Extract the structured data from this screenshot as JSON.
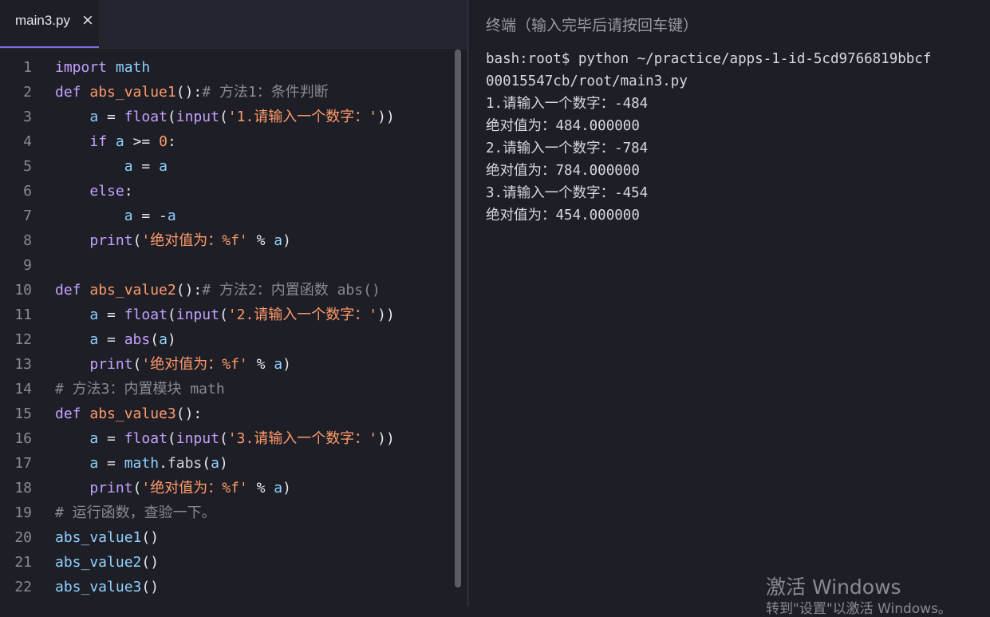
{
  "editor": {
    "tab": {
      "label": "main3.py",
      "close_icon": "×"
    },
    "lines": [
      {
        "n": "1",
        "tokens": [
          [
            "kw",
            "import"
          ],
          [
            "pl",
            " "
          ],
          [
            "id",
            "math"
          ]
        ]
      },
      {
        "n": "2",
        "tokens": [
          [
            "kw",
            "def"
          ],
          [
            "pl",
            " "
          ],
          [
            "fn",
            "abs_value1"
          ],
          [
            "op",
            "():"
          ],
          [
            "cm",
            "# 方法1：条件判断"
          ]
        ]
      },
      {
        "n": "3",
        "tokens": [
          [
            "pl",
            "    "
          ],
          [
            "id",
            "a"
          ],
          [
            "op",
            " = "
          ],
          [
            "kw",
            "float"
          ],
          [
            "op",
            "("
          ],
          [
            "kw",
            "input"
          ],
          [
            "op",
            "("
          ],
          [
            "str",
            "'1.请输入一个数字：'"
          ],
          [
            "op",
            "))"
          ]
        ]
      },
      {
        "n": "4",
        "tokens": [
          [
            "pl",
            "    "
          ],
          [
            "kw",
            "if"
          ],
          [
            "pl",
            " "
          ],
          [
            "id",
            "a"
          ],
          [
            "op",
            " >= "
          ],
          [
            "num",
            "0"
          ],
          [
            "op",
            ":"
          ]
        ]
      },
      {
        "n": "5",
        "tokens": [
          [
            "pl",
            "        "
          ],
          [
            "id",
            "a"
          ],
          [
            "op",
            " = "
          ],
          [
            "id",
            "a"
          ]
        ]
      },
      {
        "n": "6",
        "tokens": [
          [
            "pl",
            "    "
          ],
          [
            "kw",
            "else"
          ],
          [
            "op",
            ":"
          ]
        ]
      },
      {
        "n": "7",
        "tokens": [
          [
            "pl",
            "        "
          ],
          [
            "id",
            "a"
          ],
          [
            "op",
            " = -"
          ],
          [
            "id",
            "a"
          ]
        ]
      },
      {
        "n": "8",
        "tokens": [
          [
            "pl",
            "    "
          ],
          [
            "kw",
            "print"
          ],
          [
            "op",
            "("
          ],
          [
            "str",
            "'绝对值为：%f'"
          ],
          [
            "op",
            " % "
          ],
          [
            "id",
            "a"
          ],
          [
            "op",
            ")"
          ]
        ]
      },
      {
        "n": "9",
        "tokens": []
      },
      {
        "n": "10",
        "tokens": [
          [
            "kw",
            "def"
          ],
          [
            "pl",
            " "
          ],
          [
            "fn",
            "abs_value2"
          ],
          [
            "op",
            "():"
          ],
          [
            "cm",
            "# 方法2：内置函数 abs()"
          ]
        ]
      },
      {
        "n": "11",
        "tokens": [
          [
            "pl",
            "    "
          ],
          [
            "id",
            "a"
          ],
          [
            "op",
            " = "
          ],
          [
            "kw",
            "float"
          ],
          [
            "op",
            "("
          ],
          [
            "kw",
            "input"
          ],
          [
            "op",
            "("
          ],
          [
            "str",
            "'2.请输入一个数字：'"
          ],
          [
            "op",
            "))"
          ]
        ]
      },
      {
        "n": "12",
        "tokens": [
          [
            "pl",
            "    "
          ],
          [
            "id",
            "a"
          ],
          [
            "op",
            " = "
          ],
          [
            "kw",
            "abs"
          ],
          [
            "op",
            "("
          ],
          [
            "id",
            "a"
          ],
          [
            "op",
            ")"
          ]
        ]
      },
      {
        "n": "13",
        "tokens": [
          [
            "pl",
            "    "
          ],
          [
            "kw",
            "print"
          ],
          [
            "op",
            "("
          ],
          [
            "str",
            "'绝对值为：%f'"
          ],
          [
            "op",
            " % "
          ],
          [
            "id",
            "a"
          ],
          [
            "op",
            ")"
          ]
        ]
      },
      {
        "n": "14",
        "tokens": [
          [
            "cm",
            "# 方法3：内置模块 math"
          ]
        ]
      },
      {
        "n": "15",
        "tokens": [
          [
            "kw",
            "def"
          ],
          [
            "pl",
            " "
          ],
          [
            "fn",
            "abs_value3"
          ],
          [
            "op",
            "():"
          ]
        ]
      },
      {
        "n": "16",
        "tokens": [
          [
            "pl",
            "    "
          ],
          [
            "id",
            "a"
          ],
          [
            "op",
            " = "
          ],
          [
            "kw",
            "float"
          ],
          [
            "op",
            "("
          ],
          [
            "kw",
            "input"
          ],
          [
            "op",
            "("
          ],
          [
            "str",
            "'3.请输入一个数字：'"
          ],
          [
            "op",
            "))"
          ]
        ]
      },
      {
        "n": "17",
        "tokens": [
          [
            "pl",
            "    "
          ],
          [
            "id",
            "a"
          ],
          [
            "op",
            " = "
          ],
          [
            "id",
            "math"
          ],
          [
            "op",
            "."
          ],
          [
            "pl",
            "fabs"
          ],
          [
            "op",
            "("
          ],
          [
            "id",
            "a"
          ],
          [
            "op",
            ")"
          ]
        ]
      },
      {
        "n": "18",
        "tokens": [
          [
            "pl",
            "    "
          ],
          [
            "kw",
            "print"
          ],
          [
            "op",
            "("
          ],
          [
            "str",
            "'绝对值为：%f'"
          ],
          [
            "op",
            " % "
          ],
          [
            "id",
            "a"
          ],
          [
            "op",
            ")"
          ]
        ]
      },
      {
        "n": "19",
        "tokens": [
          [
            "cm",
            "# 运行函数，查验一下。"
          ]
        ]
      },
      {
        "n": "20",
        "tokens": [
          [
            "id",
            "abs_value1"
          ],
          [
            "op",
            "()"
          ]
        ]
      },
      {
        "n": "21",
        "tokens": [
          [
            "id",
            "abs_value2"
          ],
          [
            "op",
            "()"
          ]
        ]
      },
      {
        "n": "22",
        "tokens": [
          [
            "id",
            "abs_value3"
          ],
          [
            "op",
            "()"
          ]
        ]
      }
    ]
  },
  "terminal": {
    "title": "终端（输入完毕后请按回车键）",
    "lines": [
      "bash:root$ python ~/practice/apps-1-id-5cd9766819bbcf",
      "00015547cb/root/main3.py",
      "1.请输入一个数字：-484",
      "绝对值为：484.000000",
      "2.请输入一个数字：-784",
      "绝对值为：784.000000",
      "3.请输入一个数字：-454",
      "绝对值为：454.000000"
    ]
  },
  "watermark": {
    "title": "激活 Windows",
    "subtitle": "转到\"设置\"以激活 Windows。"
  }
}
